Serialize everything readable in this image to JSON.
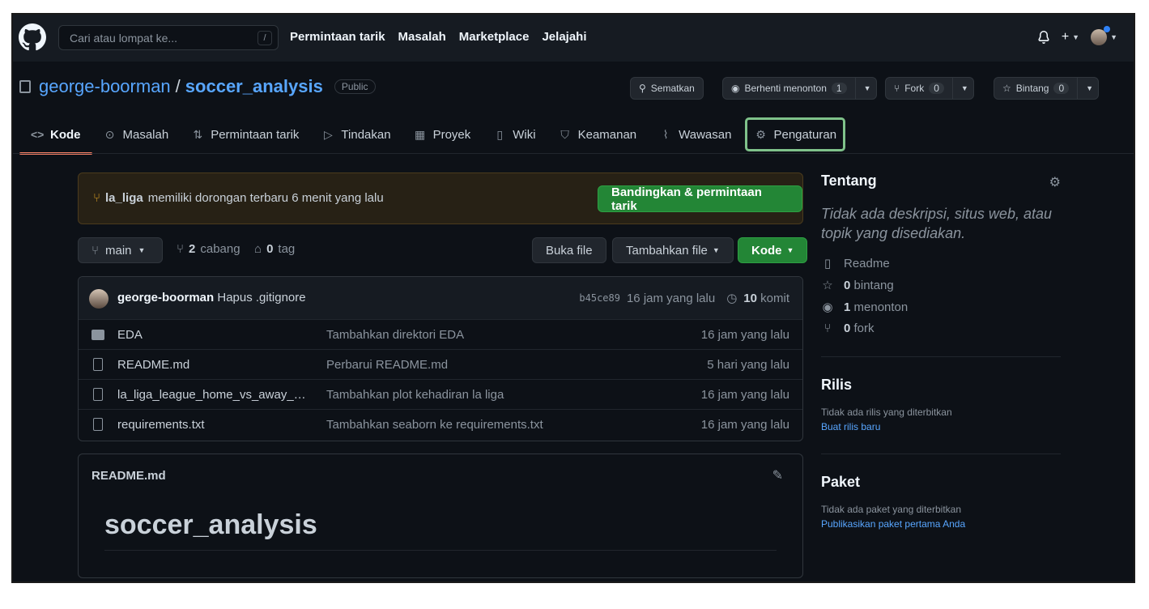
{
  "header": {
    "search_placeholder": "Cari atau lompat ke...",
    "search_shortcut": "/",
    "nav": [
      "Permintaan tarik",
      "Masalah",
      "Marketplace",
      "Jelajahi"
    ]
  },
  "repo": {
    "owner": "george-boorman",
    "separator": "/",
    "name": "soccer_analysis",
    "visibility": "Public"
  },
  "actions": {
    "pin": "Sematkan",
    "watch": "Berhenti menonton",
    "watch_count": "1",
    "fork": "Fork",
    "fork_count": "0",
    "star": "Bintang",
    "star_count": "0"
  },
  "tabs": [
    {
      "label": "Kode",
      "icon": "code-icon"
    },
    {
      "label": "Masalah",
      "icon": "issue-icon"
    },
    {
      "label": "Permintaan tarik",
      "icon": "pull-request-icon"
    },
    {
      "label": "Tindakan",
      "icon": "play-icon"
    },
    {
      "label": "Proyek",
      "icon": "table-icon"
    },
    {
      "label": "Wiki",
      "icon": "book-icon"
    },
    {
      "label": "Keamanan",
      "icon": "shield-icon"
    },
    {
      "label": "Wawasan",
      "icon": "graph-icon"
    },
    {
      "label": "Pengaturan",
      "icon": "gear-icon"
    }
  ],
  "banner": {
    "branch": "la_liga",
    "text": "memiliki dorongan terbaru 6 menit yang lalu",
    "button": "Bandingkan & permintaan tarik"
  },
  "branchbar": {
    "branch": "main",
    "branch_count": "2",
    "branch_label": "cabang",
    "tag_count": "0",
    "tag_label": "tag",
    "goto_file": "Buka file",
    "add_file": "Tambahkan file",
    "code": "Kode"
  },
  "commit": {
    "author": "george-boorman",
    "message": "Hapus .gitignore",
    "sha": "b45ce89",
    "time": "16 jam yang lalu",
    "count": "10",
    "count_label": "komit"
  },
  "files": [
    {
      "type": "folder",
      "name": "EDA",
      "message": "Tambahkan direktori EDA",
      "time": "16 jam yang lalu"
    },
    {
      "type": "file",
      "name": "README.md",
      "message": "Perbarui README.md",
      "time": "5 hari yang lalu"
    },
    {
      "type": "file",
      "name": "la_liga_league_home_vs_away_att...",
      "message": "Tambahkan plot kehadiran la liga",
      "time": "16 jam yang lalu"
    },
    {
      "type": "file",
      "name": "requirements.txt",
      "message": "Tambahkan seaborn ke requirements.txt",
      "time": "16 jam yang lalu"
    }
  ],
  "readme": {
    "header": "README.md",
    "title": "soccer_analysis"
  },
  "sidebar": {
    "about_title": "Tentang",
    "description": "Tidak ada deskripsi, situs web, atau topik yang disediakan.",
    "readme": "Readme",
    "stars_count": "0",
    "stars_label": "bintang",
    "watchers_count": "1",
    "watchers_label": "menonton",
    "forks_count": "0",
    "forks_label": "fork",
    "releases_title": "Rilis",
    "releases_text": "Tidak ada rilis yang diterbitkan",
    "releases_link": "Buat rilis baru",
    "packages_title": "Paket",
    "packages_text": "Tidak ada paket yang diterbitkan",
    "packages_link": "Publikasikan paket pertama Anda"
  }
}
